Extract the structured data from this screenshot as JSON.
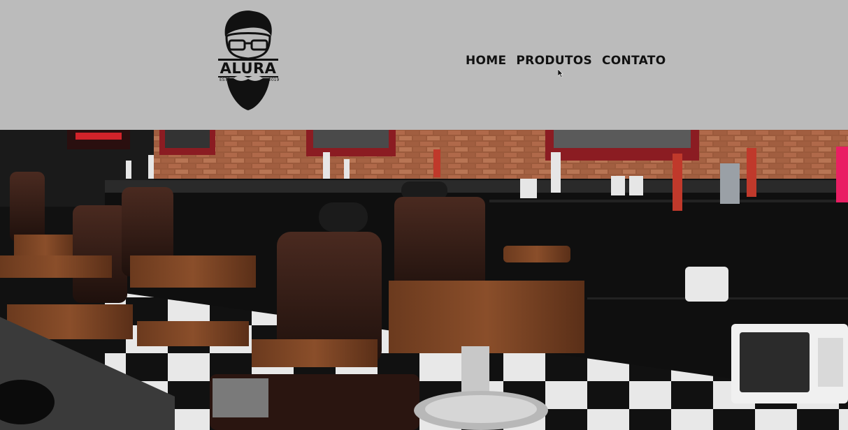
{
  "header": {
    "logo": {
      "brand": "ALURA",
      "est_label": "ESTD",
      "year": "2019",
      "icon": "bearded-man-glasses-icon"
    },
    "nav": [
      {
        "label": "HOME"
      },
      {
        "label": "PRODUTOS"
      },
      {
        "label": "CONTATO"
      }
    ]
  },
  "hero": {
    "image": "barbershop-interior-photo"
  },
  "colors": {
    "header_bg": "#bbbbbb",
    "nav_text": "#111111"
  }
}
